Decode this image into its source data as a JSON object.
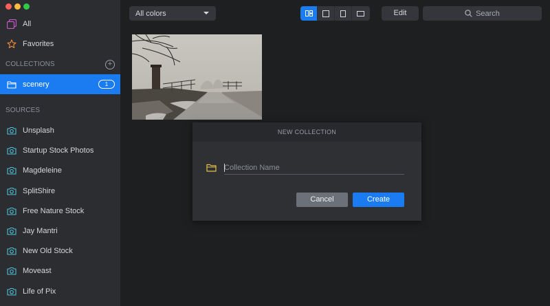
{
  "sidebar": {
    "top_items": [
      {
        "label": "All",
        "icon": "all-photos-icon"
      },
      {
        "label": "Favorites",
        "icon": "star-icon"
      }
    ],
    "collections_header": "COLLECTIONS",
    "collections": [
      {
        "label": "scenery",
        "count": "1",
        "selected": true
      }
    ],
    "sources_header": "SOURCES",
    "sources": [
      {
        "label": "Unsplash"
      },
      {
        "label": "Startup Stock Photos"
      },
      {
        "label": "Magdeleine"
      },
      {
        "label": "SplitShire"
      },
      {
        "label": "Free Nature Stock"
      },
      {
        "label": "Jay Mantri"
      },
      {
        "label": "New Old Stock"
      },
      {
        "label": "Moveast"
      },
      {
        "label": "Life of Pix"
      }
    ]
  },
  "toolbar": {
    "color_filter": "All colors",
    "view_modes": [
      "grid-view-icon",
      "single-view-icon",
      "portrait-view-icon",
      "landscape-view-icon"
    ],
    "active_view": 0,
    "edit_label": "Edit",
    "search_placeholder": "Search"
  },
  "modal": {
    "title": "NEW COLLECTION",
    "input_placeholder": "Collection Name",
    "input_value": "",
    "cancel_label": "Cancel",
    "create_label": "Create"
  },
  "colors": {
    "accent": "#1a7cf0",
    "sidebar_bg": "#2b2d31",
    "main_bg": "#1e1f21",
    "source_icon": "#4fc3d9",
    "all_icon": "#c857c9",
    "star_icon": "#f08a3c",
    "folder_icon": "#e6c14a"
  }
}
